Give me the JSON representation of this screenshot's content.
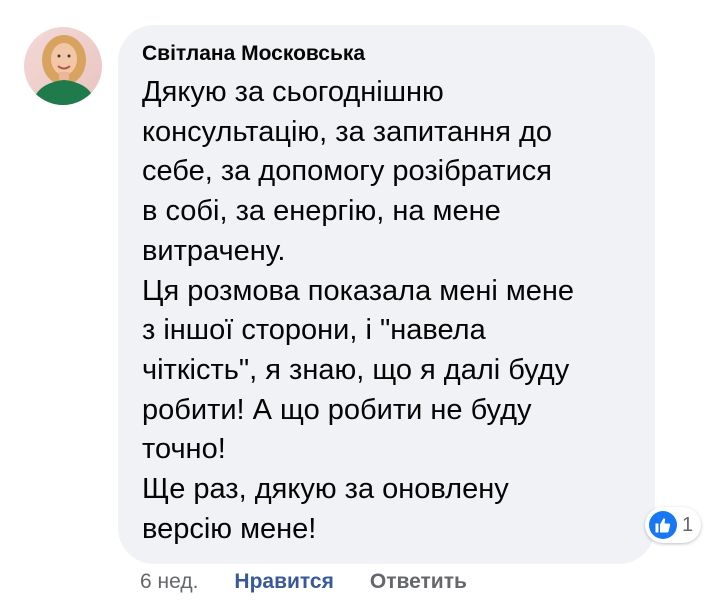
{
  "comment": {
    "author": "Світлана Московська",
    "text": "Дякую за сьогоднішню\nконсультацію, за запитання до\nсебе,  за допомогу розібратися\nв собі, за енергію, на мене\nвитрачену.\nЦя розмова показала мені мене\nз іншої сторони,  і \"навела\nчіткість\", я знаю, що я далі буду\nробити! А що робити не буду\nточно!\nЩе раз, дякую за оновлену\nверсію мене!",
    "reaction": {
      "icon": "thumbs-up-icon",
      "count": "1",
      "color": "#1877f2"
    }
  },
  "actions": {
    "timestamp": "6 нед.",
    "like_label": "Нравится",
    "like_color": "#385898",
    "reply_label": "Ответить"
  },
  "colors": {
    "bubble_background": "#f0f2f5",
    "text": "#050505",
    "secondary_text": "#65676b"
  }
}
